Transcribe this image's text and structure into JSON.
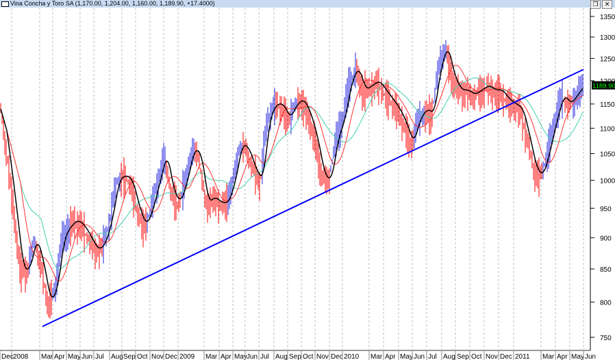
{
  "window": {
    "title": "Vina Concha y Toro SA (1,170.00, 1,204.00, 1,160.00, 1,189.90, +17.4000)",
    "restore_icon": "restore-icon",
    "close_icon": "close-icon"
  },
  "chart_data": {
    "type": "bar",
    "scale": "log",
    "ylim": [
      730,
      1370
    ],
    "yticks": [
      750,
      800,
      850,
      900,
      950,
      1000,
      1050,
      1100,
      1150,
      1200,
      1250,
      1300,
      1350
    ],
    "last_price_label": "1189.900",
    "xticks": [
      "Dec",
      "2008",
      "Mar",
      "Apr",
      "May",
      "Jun",
      "Jul",
      "Aug",
      "Sep",
      "Oct",
      "Nov",
      "Dec",
      "2009",
      "Mar",
      "Apr",
      "May",
      "Jun",
      "Jul",
      "Aug",
      "Sep",
      "Oct",
      "Nov",
      "Dec",
      "2010",
      "Mar",
      "Apr",
      "May",
      "Jun",
      "Jul",
      "Aug",
      "Sep",
      "Oct",
      "Nov",
      "Dec",
      "2011",
      "Mar",
      "Apr",
      "May",
      "Jun"
    ],
    "closes": [
      1150,
      1050,
      950,
      850,
      850,
      900,
      860,
      800,
      820,
      900,
      920,
      930,
      920,
      900,
      880,
      890,
      930,
      1000,
      1010,
      1000,
      950,
      920,
      950,
      1000,
      1050,
      980,
      960,
      1000,
      1060,
      1050,
      960,
      970,
      960,
      960,
      1000,
      1070,
      1060,
      1020,
      1000,
      1120,
      1150,
      1150,
      1120,
      1150,
      1160,
      1130,
      1080,
      1010,
      1000,
      1080,
      1120,
      1200,
      1230,
      1180,
      1190,
      1200,
      1180,
      1160,
      1140,
      1110,
      1070,
      1120,
      1140,
      1130,
      1230,
      1280,
      1210,
      1180,
      1180,
      1170,
      1180,
      1190,
      1180,
      1180,
      1160,
      1150,
      1140,
      1080,
      1020,
      1010,
      1060,
      1120,
      1170,
      1150,
      1170,
      1190
    ],
    "trendline": {
      "from": 765,
      "to": 1225
    },
    "colors": {
      "up": "#2020e0",
      "down": "#ff0000",
      "fast_ma": "#000000",
      "mid_ma": "#ff3030",
      "slow_ma": "#40d0b0",
      "trendline": "#0000ff"
    }
  }
}
